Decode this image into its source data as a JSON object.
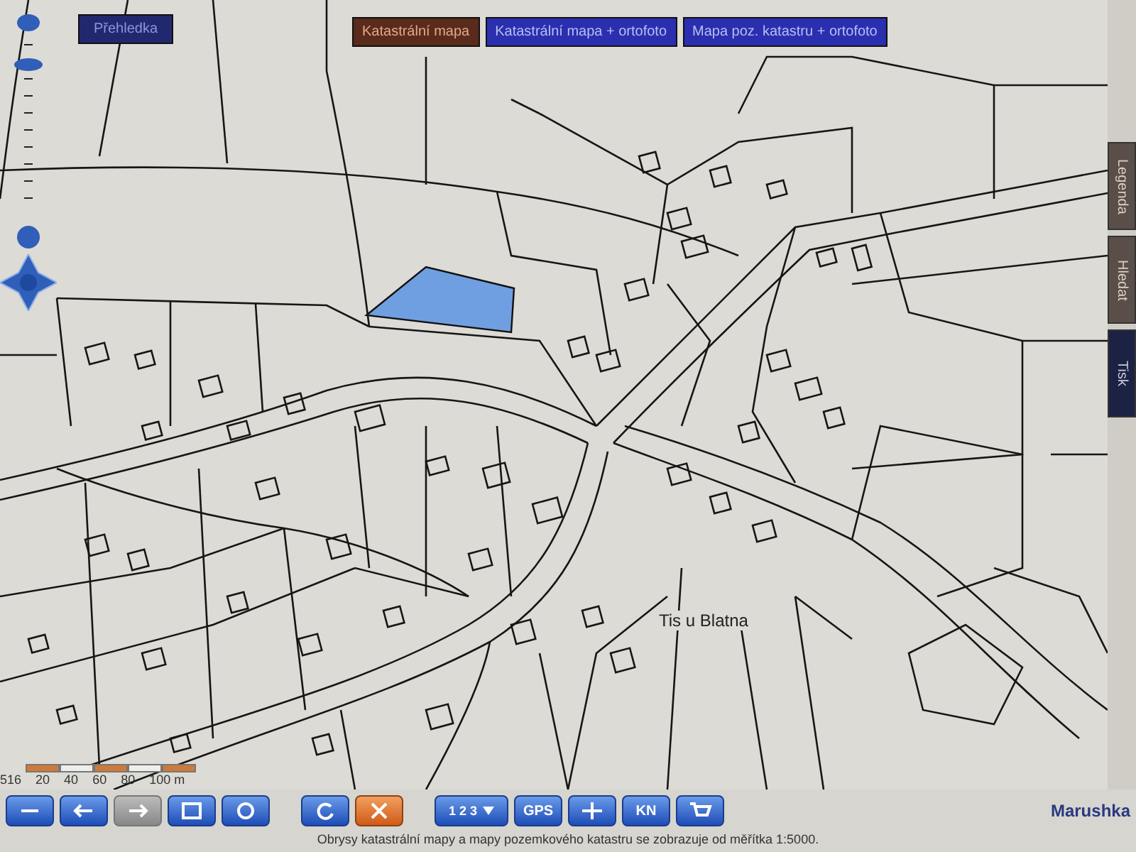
{
  "overview_button": {
    "label": "Přehledka"
  },
  "layer_tabs": [
    {
      "label": "Katastrální mapa",
      "selected": true
    },
    {
      "label": "Katastrální mapa + ortofoto",
      "selected": false
    },
    {
      "label": "Mapa poz. katastru + ortofoto",
      "selected": false
    }
  ],
  "zoom": {
    "level": 0.88
  },
  "side_tabs": [
    {
      "label": "Legenda",
      "selected": false
    },
    {
      "label": "Hledat",
      "selected": false
    },
    {
      "label": "Tisk",
      "selected": true
    }
  ],
  "map": {
    "place_label": "Tis u Blatna",
    "scale_prefix": "516",
    "scale_labels": [
      "20",
      "40",
      "60",
      "80",
      "100 m"
    ]
  },
  "toolbar": [
    {
      "kind": "minus",
      "disabled": false
    },
    {
      "kind": "left",
      "disabled": false
    },
    {
      "kind": "right",
      "disabled": true
    },
    {
      "kind": "frame",
      "disabled": false
    },
    {
      "kind": "globe",
      "disabled": false
    },
    {
      "kind": "refresh",
      "disabled": false
    },
    {
      "kind": "close",
      "disabled": false
    },
    {
      "kind": "scale",
      "label": "1 2 3",
      "disabled": false
    },
    {
      "kind": "text",
      "label": "GPS",
      "disabled": false
    },
    {
      "kind": "target",
      "disabled": false
    },
    {
      "kind": "text",
      "label": "KN",
      "disabled": false
    },
    {
      "kind": "cart",
      "disabled": false
    }
  ],
  "brand": "Marushka",
  "footer_note": "Obrysy katastrální mapy a mapy pozemkového katastru se zobrazuje od měřítka 1:5000."
}
